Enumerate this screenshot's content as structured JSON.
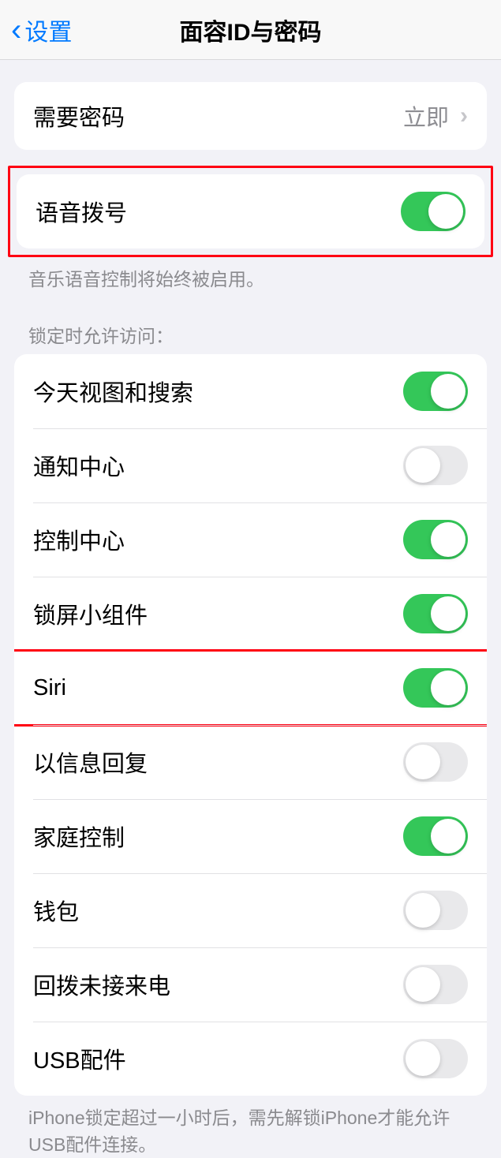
{
  "header": {
    "back_label": "设置",
    "title": "面容ID与密码"
  },
  "require_passcode": {
    "label": "需要密码",
    "value": "立即"
  },
  "voice_dial": {
    "label": "语音拨号",
    "on": true,
    "footer": "音乐语音控制将始终被启用。"
  },
  "locked_section": {
    "header": "锁定时允许访问：",
    "items": [
      {
        "label": "今天视图和搜索",
        "on": true
      },
      {
        "label": "通知中心",
        "on": false
      },
      {
        "label": "控制中心",
        "on": true
      },
      {
        "label": "锁屏小组件",
        "on": true
      },
      {
        "label": "Siri",
        "on": true
      },
      {
        "label": "以信息回复",
        "on": false
      },
      {
        "label": "家庭控制",
        "on": true
      },
      {
        "label": "钱包",
        "on": false
      },
      {
        "label": "回拨未接来电",
        "on": false
      },
      {
        "label": "USB配件",
        "on": false
      }
    ],
    "footer": "iPhone锁定超过一小时后，需先解锁iPhone才能允许USB配件连接。"
  }
}
